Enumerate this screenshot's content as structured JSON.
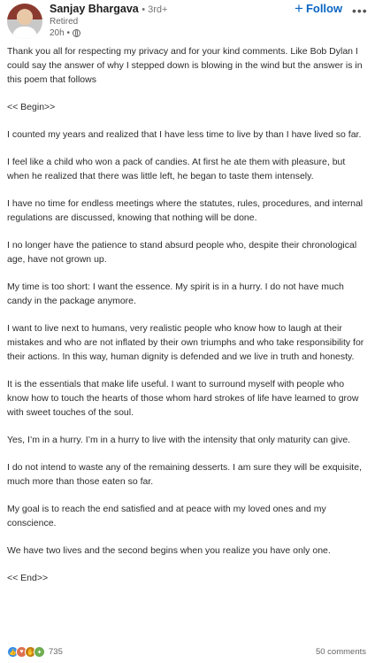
{
  "post": {
    "author": {
      "name": "Sanjay Bhargava",
      "degree": "• 3rd+",
      "headline": "Retired",
      "time": "20h •"
    },
    "follow_label": "Follow",
    "more_label": "•••",
    "paragraphs": [
      "Thank you all for respecting my privacy and for your kind comments. Like Bob Dylan I could say the answer of why I stepped down is blowing in the wind but the answer is in this poem that follows",
      "<< Begin>>",
      "I counted my years and realized that I have less time to live by than I have lived so far.",
      "I feel like a child who won a pack of candies. At first he ate them with pleasure, but when he realized that there was little left, he began to taste them intensely.",
      "I have no time for endless meetings where the statutes, rules, procedures, and internal regulations are discussed, knowing that nothing will be done.",
      "I no longer have the patience to stand absurd people who, despite their chronological age, have not grown up.",
      "My time is too short: I want the essence. My spirit is in a hurry. I do not have much candy in the package anymore.",
      "I want to live next to humans, very realistic people who know how to laugh at their mistakes and who are not inflated by their own triumphs and who take responsibility for their actions. In this way, human dignity is defended and we live in truth and honesty.",
      "It is the essentials that make life useful. I want to surround myself with people who know how to touch the hearts of those whom hard strokes of life have learned to grow with sweet touches of the soul.",
      "Yes, I’m in a hurry. I’m in a hurry to live with the intensity that only maturity can give.",
      "I do not intend to waste any of the remaining desserts. I am sure they will be exquisite, much more than those eaten so far.",
      "My goal is to reach the end satisfied and at peace with my loved ones and my conscience.",
      "We have two lives and the second begins when you realize you have only one.",
      "<< End>>"
    ],
    "reactions": {
      "icons": [
        "like-icon",
        "love-icon",
        "support-icon",
        "celebrate-icon"
      ],
      "count": "735"
    },
    "comments_label": "50 comments"
  }
}
